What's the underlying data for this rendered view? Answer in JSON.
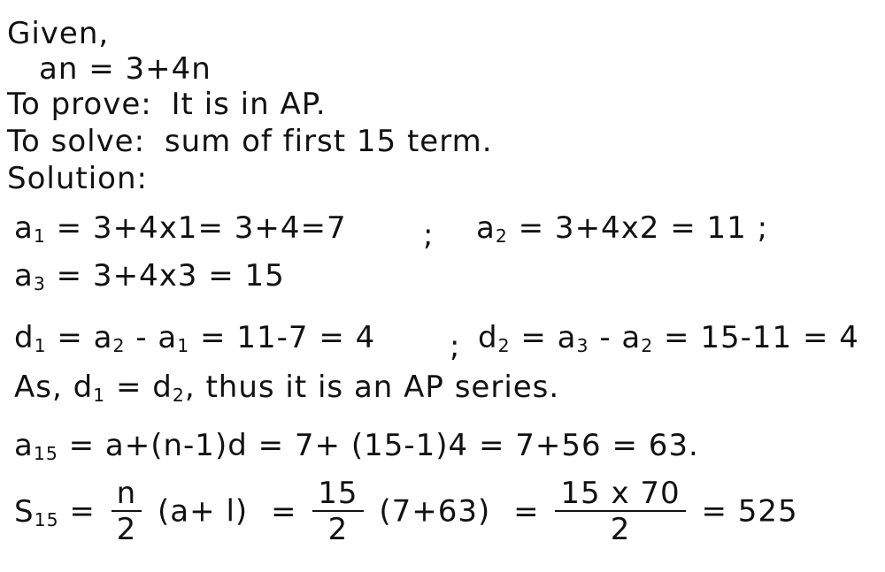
{
  "given": {
    "label": "Given,",
    "formula": "an = 3+4n"
  },
  "to_prove": {
    "label": "To prove:",
    "text": "It is in AP."
  },
  "to_solve": {
    "label": "To solve:",
    "text": "sum of first 15 term."
  },
  "solution": {
    "label": "Solution:",
    "a1": {
      "lhs": "a",
      "sub": "1",
      "rhs": "= 3+4x1= 3+4=7"
    },
    "sep1": ";",
    "a2": {
      "lhs": "a",
      "sub": "2",
      "rhs": "= 3+4x2 = 11 ;"
    },
    "a3": {
      "lhs": "a",
      "sub": "3",
      "rhs": "= 3+4x3 = 15"
    },
    "d1": {
      "lhs": "d",
      "sub": "1",
      "rhs_a": "= a",
      "rhs_a_sub": "2",
      "rhs_b": "- a",
      "rhs_b_sub": "1",
      "rhs_c": "= 11-7 = 4"
    },
    "sep2": ";",
    "d2": {
      "lhs": "d",
      "sub": "2",
      "rhs_a": "= a",
      "rhs_a_sub": "3",
      "rhs_b": "- a",
      "rhs_b_sub": "2",
      "rhs_c": "= 15-11 = 4"
    },
    "conclusion": {
      "prefix": "As, d",
      "sub1": "1",
      "mid": " = d",
      "sub2": "2",
      "suffix": ", thus it is an AP series."
    },
    "a15": {
      "lhs": "a",
      "sub": "15",
      "rhs": "= a+(n-1)d = 7+ (15-1)4 = 7+56 = 63."
    },
    "s15": {
      "lhs": "S",
      "sub": "15",
      "eq1": "=",
      "frac1_num": "n",
      "frac1_den": "2",
      "paren1": "(a+ l)",
      "eq2": "=",
      "frac2_num": "15",
      "frac2_den": "2",
      "paren2": "(7+63)",
      "eq3": "=",
      "frac3_num": "15 x 70",
      "frac3_den": "2",
      "eq4": "=",
      "result": "525"
    }
  }
}
